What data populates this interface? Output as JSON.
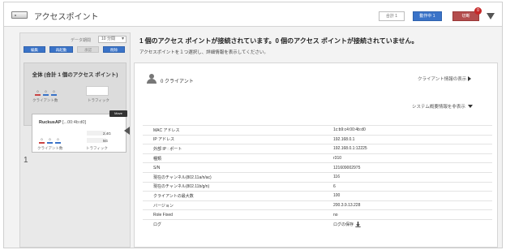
{
  "header": {
    "title": "アクセスポイント",
    "total_label": "合計 1",
    "connected_label": "動作中 1",
    "disconnected_label": "切断",
    "disconnected_badge": "0"
  },
  "toolbar": {
    "display_label": "データ期間",
    "display_value": "10 分間",
    "buttons": [
      "編集",
      "再起動",
      "承認",
      "削除"
    ]
  },
  "summary_card": {
    "title": "全体 (合計 1 個のアクセス ポイント)",
    "bars": [
      "0",
      "0",
      "0"
    ],
    "clients_label": "クライアント数",
    "traffic_label": "トラフィック"
  },
  "ap_card": {
    "index": "1",
    "name": "RuckusAP",
    "mac": "[...00:4b:d0]",
    "move_tip": "Move",
    "bars": [
      "0",
      "0",
      "0"
    ],
    "band_24": "2.4G",
    "band_5": "5G",
    "clients_label": "クライアント数",
    "traffic_label": "トラフィック"
  },
  "main": {
    "headline": "1 個のアクセス ポイントが接続されています。0 個のアクセス ポイントが接続されていません。",
    "hint": "アクセスポイントを１つ選択し、詳細情報を表示してください。",
    "clients_title": "0 クライアント",
    "client_info_link": "クライアント情報の表示",
    "system_summary_toggle": "システム概要情報を非表示",
    "rows": [
      {
        "label": "MAC アドレス",
        "value": "1c:b9:c4:00:4b:d0"
      },
      {
        "label": "IP アドレス",
        "value": "192.168.0.1"
      },
      {
        "label": "外部 IP : ポート",
        "value": "192.168.0.1:12225"
      },
      {
        "label": "種類",
        "value": "r310"
      },
      {
        "label": "S/N",
        "value": "121609002975"
      },
      {
        "label": "現在のチャンネル(802.11a/n/ac)",
        "value": "116"
      },
      {
        "label": "現在のチャンネル(802.11b/g/n)",
        "value": "6"
      },
      {
        "label": "クライアントの最大数",
        "value": "100"
      },
      {
        "label": "バージョン",
        "value": "200.3.9.13.228"
      },
      {
        "label": "Role Fixed",
        "value": "no"
      },
      {
        "label": "ログ",
        "value": "ログの保存"
      }
    ]
  },
  "colors": {
    "accent_blue": "#3a73c8",
    "alert_red": "#b34d4d",
    "bar_blue": "#3a73c8",
    "bar_red": "#c94444"
  }
}
